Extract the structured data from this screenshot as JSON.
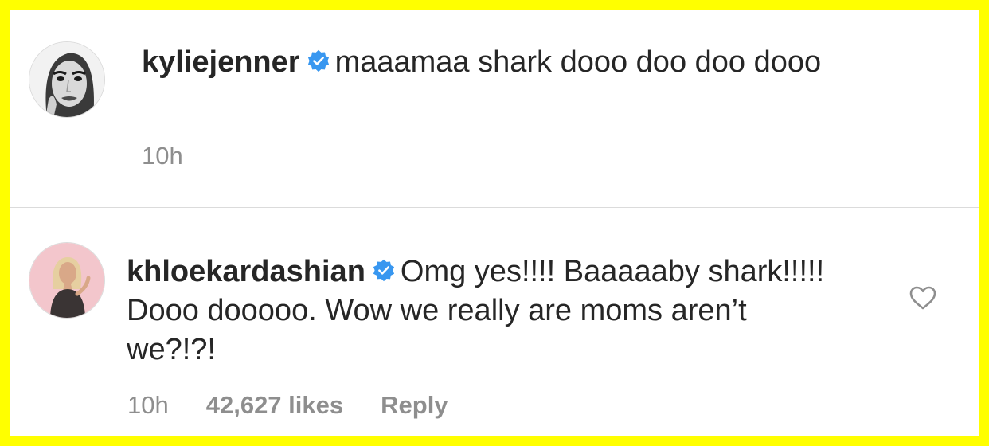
{
  "comments": [
    {
      "username": "kyliejenner",
      "verified": true,
      "text": "maaamaa shark dooo doo doo dooo",
      "time": "10h"
    },
    {
      "username": "khloekardashian",
      "verified": true,
      "text": "Omg yes!!!! Baaaaaby shark!!!!! Dooo dooooo. Wow we really are moms aren’t we?!?!",
      "time": "10h",
      "likes": "42,627 likes",
      "reply_label": "Reply"
    }
  ],
  "colors": {
    "frame": "#ffff00",
    "verified": "#3897f0",
    "meta": "#8e8e8e",
    "text": "#262626"
  },
  "icons": {
    "verified": "verified-badge-icon",
    "like": "heart-outline-icon"
  }
}
